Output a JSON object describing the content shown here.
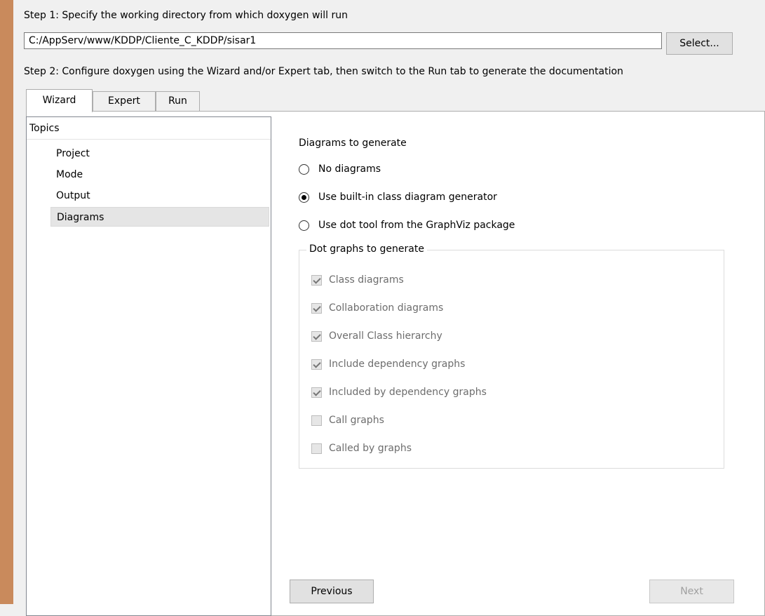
{
  "step1": {
    "label": "Step 1: Specify the working directory from which doxygen will run"
  },
  "working_dir": {
    "value": "C:/AppServ/www/KDDP/Cliente_C_KDDP/sisar1"
  },
  "select_button": {
    "label": "Select..."
  },
  "step2": {
    "label": "Step 2: Configure doxygen using the Wizard and/or Expert tab, then switch to the Run tab to generate the documentation"
  },
  "tabs": [
    {
      "label": "Wizard",
      "active": true
    },
    {
      "label": "Expert",
      "active": false
    },
    {
      "label": "Run",
      "active": false
    }
  ],
  "topics": {
    "header": "Topics",
    "items": [
      "Project",
      "Mode",
      "Output",
      "Diagrams"
    ],
    "selected": "Diagrams"
  },
  "diagrams": {
    "title": "Diagrams to generate",
    "options": [
      {
        "label": "No diagrams",
        "checked": false
      },
      {
        "label": "Use built-in class diagram generator",
        "checked": true
      },
      {
        "label": "Use dot tool from the GraphViz package",
        "checked": false
      }
    ],
    "dot_group": {
      "title": "Dot graphs to generate",
      "items": [
        {
          "label": "Class diagrams",
          "checked": true
        },
        {
          "label": "Collaboration diagrams",
          "checked": true
        },
        {
          "label": "Overall Class hierarchy",
          "checked": true
        },
        {
          "label": "Include dependency graphs",
          "checked": true
        },
        {
          "label": "Included by dependency graphs",
          "checked": true
        },
        {
          "label": "Call graphs",
          "checked": false
        },
        {
          "label": "Called by graphs",
          "checked": false
        }
      ]
    }
  },
  "nav": {
    "previous": "Previous",
    "next": "Next"
  },
  "colors": {
    "window_frame": "#c98a5c",
    "disabled_text": "#6d6d6d"
  }
}
